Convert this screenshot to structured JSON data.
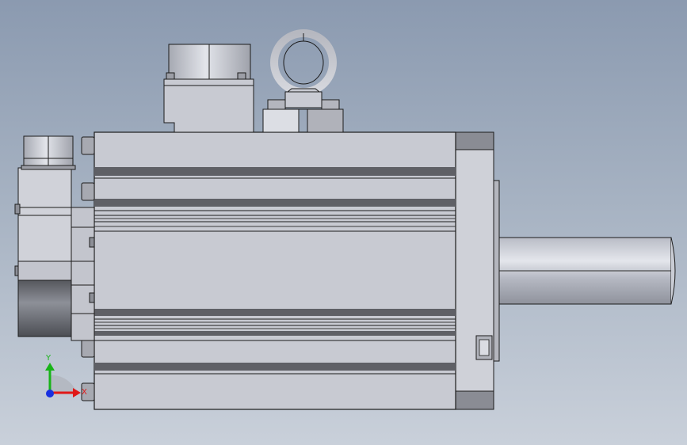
{
  "view": {
    "background_top": "#8b9ab0",
    "background_bottom": "#c9d0da",
    "part_fill": "#c8cad2",
    "part_stroke": "#1c1c1c",
    "dark_band": "#5f6066"
  },
  "triad": {
    "x_label": "X",
    "y_label": "Y",
    "x_color": "#e01818",
    "y_color": "#18b418",
    "z_color": "#1830e0"
  }
}
